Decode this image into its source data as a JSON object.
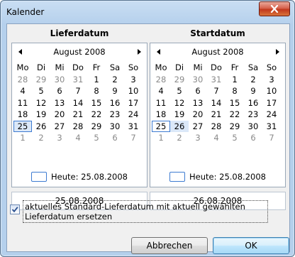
{
  "window": {
    "title": "Kalender"
  },
  "left": {
    "heading": "Lieferdatum",
    "month": "August 2008",
    "weekdays": [
      "Mo",
      "Di",
      "Mi",
      "Do",
      "Fr",
      "Sa",
      "So"
    ],
    "weeks": [
      [
        "28",
        "29",
        "30",
        "31",
        "1",
        "2",
        "3"
      ],
      [
        "4",
        "5",
        "6",
        "7",
        "8",
        "9",
        "10"
      ],
      [
        "11",
        "12",
        "13",
        "14",
        "15",
        "16",
        "17"
      ],
      [
        "18",
        "19",
        "20",
        "21",
        "22",
        "23",
        "24"
      ],
      [
        "25",
        "26",
        "27",
        "28",
        "29",
        "30",
        "31"
      ],
      [
        "1",
        "2",
        "3",
        "4",
        "5",
        "6",
        "7"
      ]
    ],
    "today_text": "Heute: 25.08.2008",
    "date_value": "25.08.2008"
  },
  "right": {
    "heading": "Startdatum",
    "month": "August 2008",
    "weekdays": [
      "Mo",
      "Di",
      "Mi",
      "Do",
      "Fr",
      "Sa",
      "So"
    ],
    "weeks": [
      [
        "28",
        "29",
        "30",
        "31",
        "1",
        "2",
        "3"
      ],
      [
        "4",
        "5",
        "6",
        "7",
        "8",
        "9",
        "10"
      ],
      [
        "11",
        "12",
        "13",
        "14",
        "15",
        "16",
        "17"
      ],
      [
        "18",
        "19",
        "20",
        "21",
        "22",
        "23",
        "24"
      ],
      [
        "25",
        "26",
        "27",
        "28",
        "29",
        "30",
        "31"
      ],
      [
        "1",
        "2",
        "3",
        "4",
        "5",
        "6",
        "7"
      ]
    ],
    "today_text": "Heute: 25.08.2008",
    "date_value": "26.08.2008"
  },
  "option": {
    "label": "aktuelles Standard-Lieferdatum mit aktuell gewählten Lieferdatum ersetzen",
    "checked": true
  },
  "buttons": {
    "cancel_label": "Abbrechen",
    "ok_label": "OK"
  },
  "colors": {
    "accent": "#3d7bd1",
    "close": "#c1381d",
    "selection": "#dbe8f8"
  }
}
